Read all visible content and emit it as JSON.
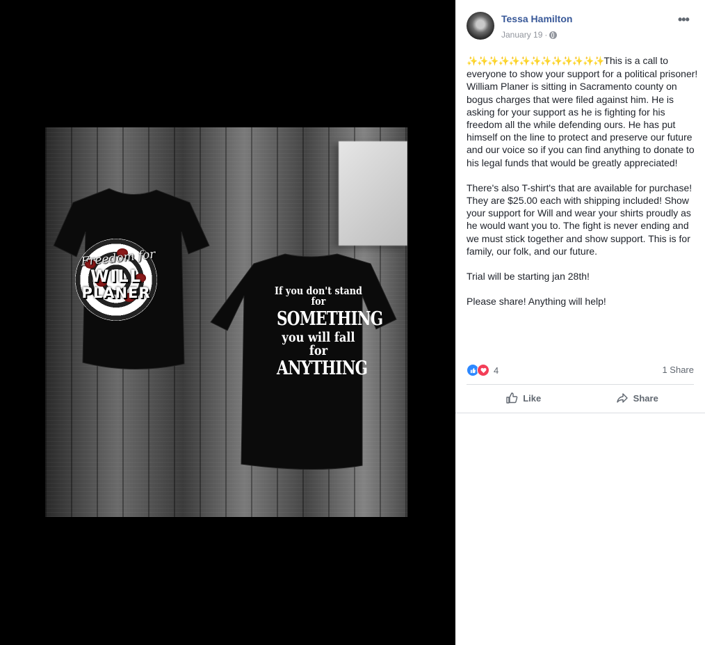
{
  "post": {
    "author": "Tessa Hamilton",
    "date": "January 19",
    "date_separator": "·",
    "privacy_icon": "globe-icon",
    "more_label": "•••",
    "decoration": "✨✨✨✨✨✨✨✨✨✨✨✨✨",
    "paragraph1": "This is a call to everyone to show your support for a political prisoner! William Planer is sitting in Sacramento county on bogus charges that were filed against him. He is asking for your support as he is fighting for his freedom all the while defending ours. He has put himself on the line to protect and preserve our future and our voice so if you can find anything to donate to his legal funds that would be greatly appreciated!",
    "paragraph2": "There's also T-shirt's that are available for purchase! They are $25.00 each with shipping included! Show your support for Will and wear your shirts proudly as he would want you to. The fight is never ending and we must stick together and show support. This is for family, our folk, and our future.",
    "paragraph3": "Trial will be starting jan 28th!",
    "paragraph4": "Please share! Anything will help!"
  },
  "engagement": {
    "reaction_count": "4",
    "shares": "1 Share",
    "like_label": "Like",
    "share_label": "Share",
    "accent": "#385898",
    "like_color": "#2d88ff",
    "love_color": "#f33e58"
  },
  "photo": {
    "front_line1": "Freedom for",
    "front_line2": "WILL",
    "front_line3": "PLANER",
    "back_line1": "If you don't stand for",
    "back_line2": "SOMETHING",
    "back_line3": "you will fall for",
    "back_line4": "ANYTHING"
  }
}
